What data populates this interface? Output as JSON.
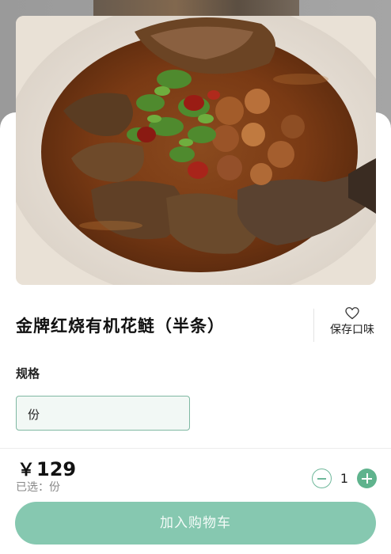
{
  "product": {
    "title": "金牌红烧有机花鲢（半条）",
    "favorite_label": "保存口味"
  },
  "spec": {
    "label": "规格",
    "selected_option": "份"
  },
  "footer": {
    "price_symbol": "￥",
    "price": "129",
    "selected_text": "已选：份",
    "quantity": "1",
    "add_to_cart_label": "加入购物车"
  },
  "colors": {
    "accent": "#5fb38d",
    "button": "#86c8b0",
    "option_border": "#7fb8a2"
  }
}
